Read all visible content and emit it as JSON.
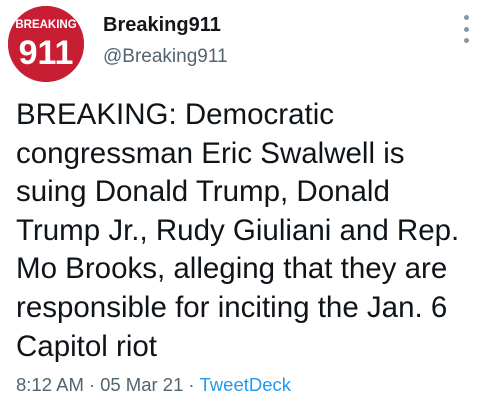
{
  "tweet": {
    "avatar_text": "BREAKING 911",
    "display_name": "Breaking911",
    "handle": "@Breaking911",
    "body_lines": [
      "BREAKING: Democratic",
      "congressman Eric Swalwell is",
      "suing Donald Trump, Donald",
      "Trump Jr., Rudy Giuliani and Rep.",
      "Mo Brooks, alleging that they are",
      "responsible for inciting the Jan. 6",
      "Capitol riot"
    ],
    "time": "8:12 AM",
    "date": "05 Mar 21",
    "source": "TweetDeck",
    "separator": "·"
  },
  "icons": {
    "more": "more-vertical-icon"
  },
  "colors": {
    "brand_red": "#c81e33",
    "link": "#1d9bf0",
    "muted": "#536471"
  }
}
